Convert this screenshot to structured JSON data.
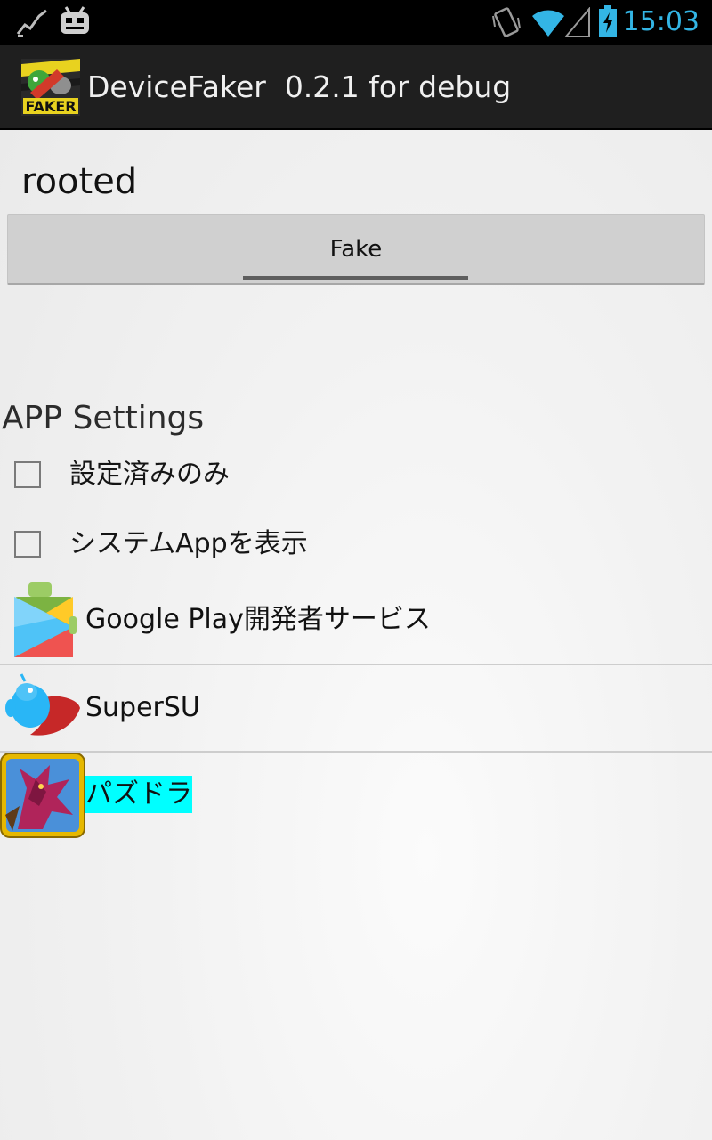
{
  "status_bar": {
    "time": "15:03",
    "icons": [
      "activity-graph-icon",
      "cyanogenmod-android-icon",
      "vibrate-icon",
      "wifi-icon",
      "cell-signal-icon",
      "battery-charging-icon"
    ],
    "time_color": "#33b5e5"
  },
  "action_bar": {
    "logo_text": "FAKER",
    "title": "DeviceFaker  0.2.1 for debug"
  },
  "main": {
    "root_status": "rooted",
    "fake_button_label": "Fake"
  },
  "app_settings": {
    "header": "APP Settings",
    "checkboxes": [
      {
        "label": "設定済みのみ",
        "checked": false
      },
      {
        "label": "システムAppを表示",
        "checked": false
      }
    ],
    "apps": [
      {
        "name": "Google Play開発者サービス",
        "icon": "google-play-services-icon",
        "highlighted": false
      },
      {
        "name": "SuperSU",
        "icon": "supersu-icon",
        "highlighted": false
      },
      {
        "name": "パズドラ",
        "icon": "puzzle-dragons-icon",
        "highlighted": true
      }
    ],
    "highlight_color": "#00ffff"
  }
}
